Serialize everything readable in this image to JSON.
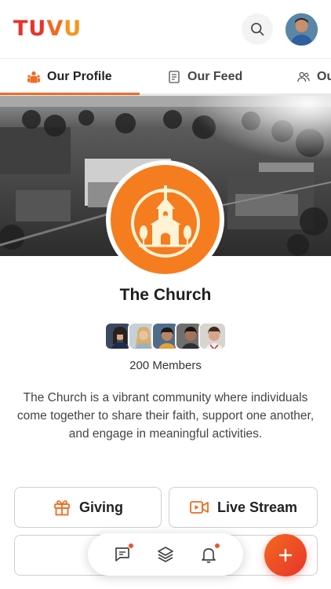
{
  "header": {
    "logo_parts": [
      "TU",
      "V",
      "U"
    ],
    "search_icon": "search-icon",
    "avatar_label": "user-avatar"
  },
  "tabs": [
    {
      "label": "Our Profile",
      "icon": "group-person-icon",
      "active": true
    },
    {
      "label": "Our Feed",
      "icon": "document-icon",
      "active": false
    },
    {
      "label": "Ou",
      "icon": "people-icon",
      "active": false
    }
  ],
  "church": {
    "name": "The Church",
    "members_count": "200 Members",
    "description": "The Church is a vibrant community where individuals come together to share their faith, support one another, and engage in meaningful activities."
  },
  "actions": {
    "giving": "Giving",
    "live_stream": "Live Stream"
  },
  "colors": {
    "accent": "#f26a1f",
    "brand_red": "#e8332b",
    "church_logo_bg": "#f57c1f"
  }
}
